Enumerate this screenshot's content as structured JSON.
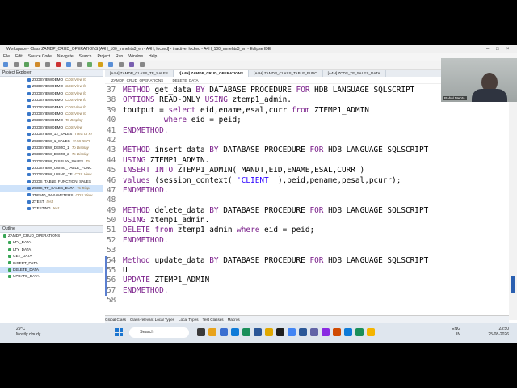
{
  "window": {
    "title": "Workspace - Class ZAMDP_CRUD_OPERATIONS [A4H_100_mmehta3_en - A4H, locked] - inactive, locked - A4H_100_mmehta3_en - Eclipse IDE"
  },
  "menu": [
    "File",
    "Edit",
    "Source Code",
    "Navigate",
    "Search",
    "Project",
    "Run",
    "Window",
    "Help"
  ],
  "project_explorer": {
    "title": "Project Explorer",
    "items": [
      {
        "name": "ZCDSVIEWDEMO",
        "desc": "CDS View fo"
      },
      {
        "name": "ZCDSVIEWDEMO",
        "desc": "CDS View fo"
      },
      {
        "name": "ZCDSVIEWDEMO",
        "desc": "CDS View fo"
      },
      {
        "name": "ZCDSVIEWDEMO",
        "desc": "CDS View fo"
      },
      {
        "name": "ZCDSVIEWDEMO",
        "desc": "CDS View fo"
      },
      {
        "name": "ZCDSVIEWDEMO",
        "desc": "CDS View fo"
      },
      {
        "name": "ZCDSVIEWDEMO",
        "desc": "To Display"
      },
      {
        "name": "ZCDSVIEWDEMO",
        "desc": "CDS View"
      },
      {
        "name": "ZCDSVIEW_12_SALES",
        "desc": "THIS IS FI"
      },
      {
        "name": "ZCDSVIEW_1_SALES",
        "desc": "THIS IS FI"
      },
      {
        "name": "ZCDSVIEW_DEMO_1",
        "desc": "To Display"
      },
      {
        "name": "ZCDSVIEW_DEMO_2",
        "desc": "To Display"
      },
      {
        "name": "ZCDSVIEW_DISPLAY_SALES",
        "desc": "To"
      },
      {
        "name": "ZCDSVIEW_USING_TABLE_FUNC",
        "desc": ""
      },
      {
        "name": "ZCDSVIEW_USING_TF",
        "desc": "CDS View"
      },
      {
        "name": "ZCDS_TABLE_FUNCTION_SALES",
        "desc": ""
      },
      {
        "name": "ZCDS_TF_SALES_DATA",
        "desc": "To Displ"
      },
      {
        "name": "ZDEMO_PARAMETERS",
        "desc": "CDS View"
      },
      {
        "name": "ZTEST",
        "desc": "test"
      },
      {
        "name": "ZTESTING",
        "desc": "test"
      }
    ]
  },
  "outline": {
    "title": "Outline",
    "items": [
      "ZAMDP_CRUD_OPERATIONS",
      "LTY_DATA",
      "LTY_DATA",
      "GET_DATA",
      "INSERT_DATA",
      "DELETE_DATA",
      "UPDATE_DATA"
    ]
  },
  "editor": {
    "tabs": [
      "[A4H] ZAMDP_CLASS_TF_SALES",
      "*[A4H] ZAMDP_CRUD_OPERATIONS",
      "[A4H] ZAMDP_CLASS_TABLE_FUNC",
      "[A4H] ZCDS_TF_SALES_DATA"
    ],
    "breadcrumb": [
      "ZAMDP_CRUD_OPERATIONS",
      "DELETE_DATA"
    ]
  },
  "code": [
    {
      "n": "37",
      "segs": [
        [
          "kw",
          "METHOD"
        ],
        [
          "",
          "get_data "
        ],
        [
          "kw",
          "BY"
        ],
        [
          "",
          "DATABASE PROCEDURE "
        ],
        [
          "kw",
          "FOR"
        ],
        [
          "",
          "HDB LANGUAGE SQLSCRIPT"
        ]
      ]
    },
    {
      "n": "38",
      "segs": [
        [
          "kw",
          "OPTIONS"
        ],
        [
          "",
          "READ-ONLY "
        ],
        [
          "kw",
          "USING"
        ],
        [
          "",
          "ztemp1_admin."
        ]
      ]
    },
    {
      "n": "39",
      "segs": [
        [
          "",
          "toutput = "
        ],
        [
          "kw",
          "select"
        ],
        [
          "",
          "eid,ename,esal,curr "
        ],
        [
          "kw",
          "from"
        ],
        [
          "",
          "ZTEMP1_ADMIN"
        ]
      ]
    },
    {
      "n": "40",
      "segs": [
        [
          "",
          "         "
        ],
        [
          "kw",
          "where"
        ],
        [
          "",
          "eid = peid;"
        ]
      ]
    },
    {
      "n": "41",
      "segs": [
        [
          "kw",
          "ENDMETHOD."
        ]
      ]
    },
    {
      "n": "42",
      "segs": []
    },
    {
      "n": "43",
      "segs": [
        [
          "kw",
          "METHOD"
        ],
        [
          "",
          "insert_data "
        ],
        [
          "kw",
          "BY"
        ],
        [
          "",
          "DATABASE PROCEDURE "
        ],
        [
          "kw",
          "FOR"
        ],
        [
          "",
          "HDB LANGUAGE SQLSCRIPT"
        ]
      ]
    },
    {
      "n": "44",
      "segs": [
        [
          "kw",
          "USING"
        ],
        [
          "",
          "ZTEMP1_ADMIN."
        ]
      ]
    },
    {
      "n": "45",
      "segs": [
        [
          "kw",
          "INSERT INTO"
        ],
        [
          "",
          "ZTEMP1_ADMIN( MANDT,EID,ENAME,ESAL,CURR )"
        ]
      ]
    },
    {
      "n": "46",
      "segs": [
        [
          "kw",
          "values"
        ],
        [
          "",
          "(session_context( "
        ],
        [
          "str",
          "'CLIENT'"
        ],
        [
          "",
          "),peid,pename,pesal,pcurr);"
        ]
      ]
    },
    {
      "n": "47",
      "segs": [
        [
          "kw",
          "ENDMETHOD."
        ]
      ]
    },
    {
      "n": "48",
      "segs": []
    },
    {
      "n": "49",
      "segs": [
        [
          "kw",
          "METHOD"
        ],
        [
          "",
          "delete_data "
        ],
        [
          "kw",
          "BY"
        ],
        [
          "",
          "DATABASE PROCEDURE "
        ],
        [
          "kw",
          "FOR"
        ],
        [
          "",
          "HDB LANGUAGE SQLSCRIPT"
        ]
      ]
    },
    {
      "n": "50",
      "segs": [
        [
          "kw",
          "USING"
        ],
        [
          "",
          "ztemp1_admin."
        ]
      ]
    },
    {
      "n": "51",
      "segs": [
        [
          "kw",
          "DELETE"
        ],
        [
          "kw",
          "from"
        ],
        [
          "",
          "ztemp1_admin "
        ],
        [
          "kw",
          "where"
        ],
        [
          "",
          "eid = peid;"
        ]
      ]
    },
    {
      "n": "52",
      "segs": [
        [
          "kw",
          "ENDMETHOD."
        ]
      ]
    },
    {
      "n": "53",
      "segs": []
    },
    {
      "n": "54",
      "segs": [
        [
          "kw",
          "Method"
        ],
        [
          "",
          "update_data "
        ],
        [
          "kw",
          "BY"
        ],
        [
          "",
          "DATABASE PROCEDURE "
        ],
        [
          "kw",
          "FOR"
        ],
        [
          "",
          "HDB LANGUAGE SQLSCRIPT"
        ]
      ]
    },
    {
      "n": "55",
      "segs": [
        [
          "",
          "U"
        ]
      ]
    },
    {
      "n": "56",
      "segs": [
        [
          "kw",
          "UPDATE"
        ],
        [
          "",
          "ZTEMP1_ADMIN"
        ]
      ]
    },
    {
      "n": "57",
      "segs": [
        [
          "kw",
          "ENDMETHOD."
        ]
      ]
    },
    {
      "n": "58",
      "segs": []
    }
  ],
  "bottom_tabs": [
    "Global Class",
    "Class-relevant Local Types",
    "Local Types",
    "Test Classes",
    "Macros"
  ],
  "taskbar": {
    "temp": "29°C",
    "weather": "Mostly cloudy",
    "search": "Search",
    "lang1": "ENG",
    "lang2": "IN",
    "time": "23:50",
    "date": "25-08-2026"
  },
  "webcam": {
    "name": "Rahul Mehta"
  },
  "colors": {
    "keyword": "#7a1f8a",
    "string": "#2a00ff",
    "marker": "#5b7fd0"
  }
}
